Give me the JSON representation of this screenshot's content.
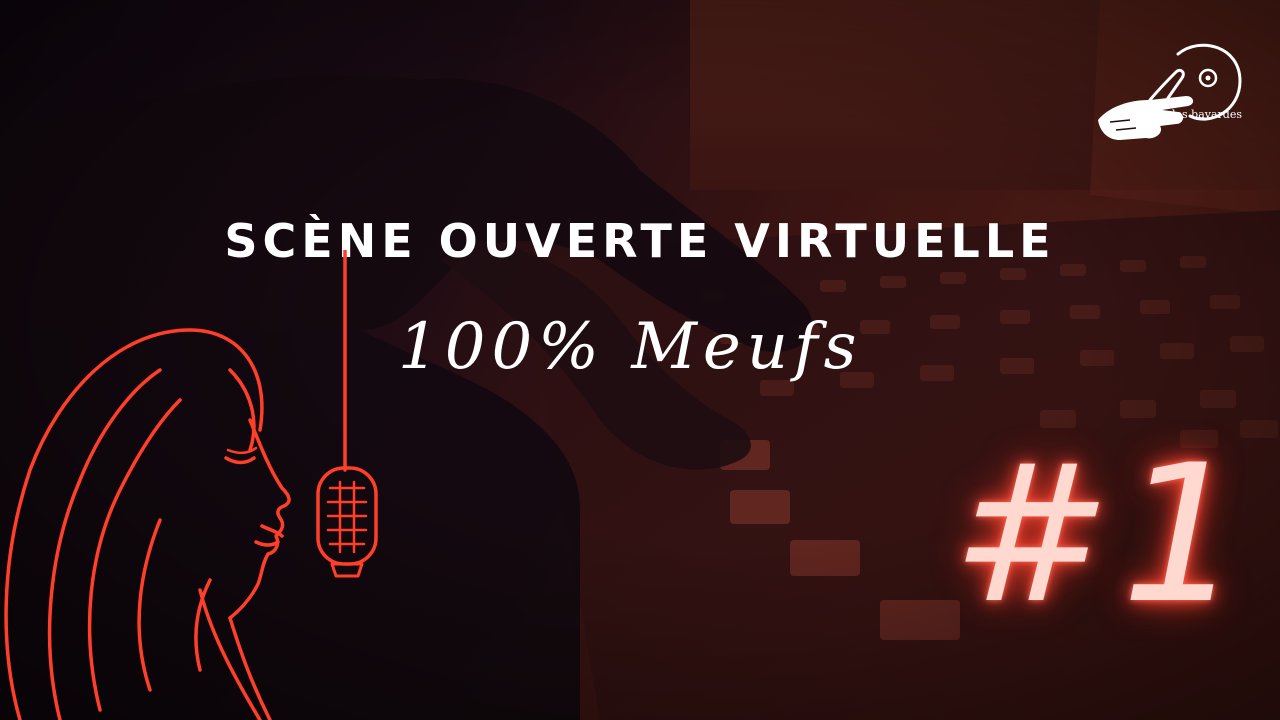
{
  "poster": {
    "title": "SCÈNE OUVERTE VIRTUELLE",
    "subtitle": "100% Meufs",
    "episode": "#1",
    "logo_text": "les bavardes"
  },
  "colors": {
    "accent": "#ff4a38",
    "line_art": "#ff3f2a",
    "text": "#ffffff",
    "background_dark": "#1a0d14",
    "background_warm": "#4a1a14"
  },
  "icons": {
    "logo": "pointing-hand-record-icon",
    "illustration": "woman-singing-microphone-icon"
  }
}
